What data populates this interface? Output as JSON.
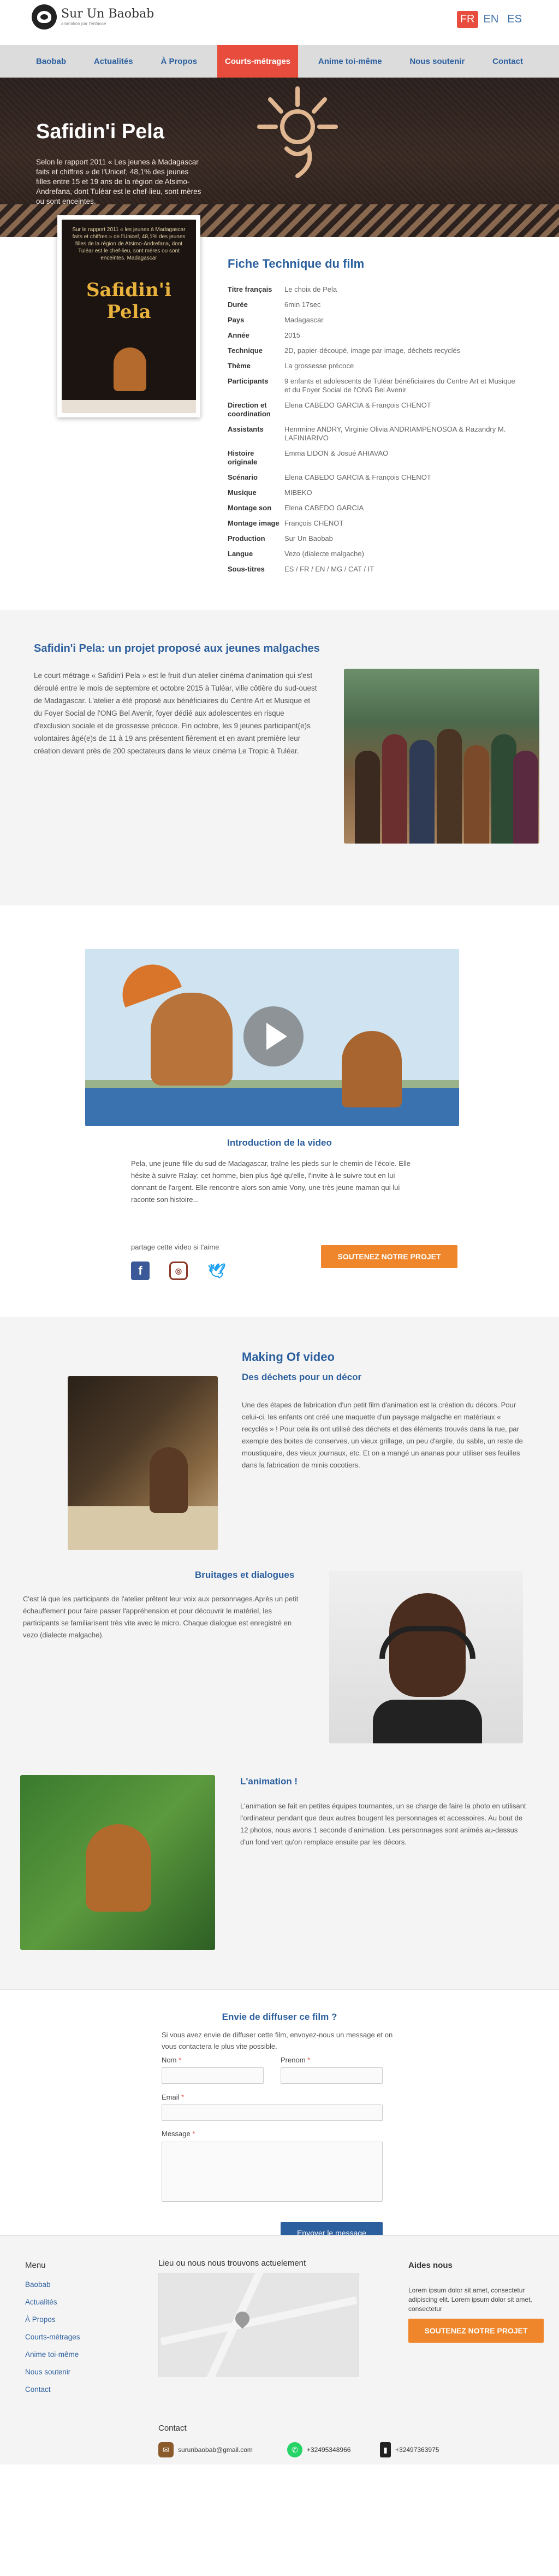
{
  "brand": {
    "name": "Sur Un Baobab",
    "tagline": "animation par l'enfance"
  },
  "languages": [
    {
      "code": "FR",
      "active": true
    },
    {
      "code": "EN",
      "active": false
    },
    {
      "code": "ES",
      "active": false
    }
  ],
  "nav": [
    {
      "label": "Baobab",
      "active": false
    },
    {
      "label": "Actualités",
      "active": false
    },
    {
      "label": "À Propos",
      "active": false
    },
    {
      "label": "Courts-métrages",
      "active": true
    },
    {
      "label": "Anime toi-même",
      "active": false
    },
    {
      "label": "Nous soutenir",
      "active": false
    },
    {
      "label": "Contact",
      "active": false
    }
  ],
  "hero": {
    "title": "Safidin'i Pela",
    "text": "Selon le rapport 2011 « Les jeunes à Madagascar faits et chiffres » de l'Unicef, 48,1% des jeunes filles entre 15 et 19 ans de la région de Atsimo-Andrefana, dont Tuléar est le chef-lieu, sont mères ou sont enceintes."
  },
  "poster": {
    "top_text": "Sur le rapport 2011 « les jeunes à Madagascar faits et chiffres » de l'Unicef, 48,1% des jeunes filles de la région de Atsimo-Andrefana, dont Tuléar est le chef-lieu, sont mères ou sont enceintes. Madagascar",
    "title": "Safidin'i Pela"
  },
  "fiche": {
    "title": "Fiche Technique du film",
    "rows": [
      {
        "k": "Titre français",
        "v": "Le choix de Pela"
      },
      {
        "k": "Durée",
        "v": "6min 17sec"
      },
      {
        "k": "Pays",
        "v": "Madagascar"
      },
      {
        "k": "Année",
        "v": "2015"
      },
      {
        "k": "Technique",
        "v": "2D, papier-découpé, image par image, déchets recyclés"
      },
      {
        "k": "Thème",
        "v": "La grossesse précoce"
      },
      {
        "k": "Participants",
        "v": "9 enfants et adolescents de Tuléar bénéficiaires du Centre Art et Musique et du Foyer Social de l'ONG Bel Avenir"
      },
      {
        "k": "Direction et coordination",
        "v": "Elena CABEDO GARCIA & François CHENOT"
      },
      {
        "k": "Assistants",
        "v": "Henrmine ANDRY, Virginie Olivia ANDRIAMPENOSOA & Razandry M. LAFINIARIVO"
      },
      {
        "k": "Histoire originale",
        "v": "Emma LIDON & Josué AHIAVAO"
      },
      {
        "k": "Scénario",
        "v": "Elena CABEDO GARCIA & François CHENOT"
      },
      {
        "k": "Musique",
        "v": "MIBEKO"
      },
      {
        "k": "Montage son",
        "v": "Elena CABEDO GARCIA"
      },
      {
        "k": "Montage image",
        "v": "François CHENOT"
      },
      {
        "k": "Production",
        "v": "Sur Un Baobab"
      },
      {
        "k": "Langue",
        "v": "Vezo (dialecte malgache)"
      },
      {
        "k": "Sous-titres",
        "v": "ES / FR / EN / MG / CAT / IT"
      }
    ]
  },
  "projet": {
    "title": "Safidin'i Pela: un projet proposé aux jeunes malgaches",
    "text": "Le court métrage « Safidin'i Pela » est le fruit d'un atelier cinéma d'animation qui s'est déroulé entre le mois de septembre et octobre 2015 à Tuléar, ville côtière du sud-ouest de Madagascar. L'atelier a été proposé aux bénéficiaires du Centre Art et Musique et du Foyer Social de l'ONG Bel Avenir, foyer dédié aux adolescentes en risque d'exclusion sociale et de grossesse précoce. Fin octobre, les 9 jeunes participant(e)s volontaires âgé(e)s de 11 à 19 ans présentent fièrement et en avant première leur création devant près de 200 spectateurs dans le vieux cinéma Le Tropic à Tuléar."
  },
  "video": {
    "title": "Introduction de la video",
    "text": "Pela, une jeune fille du sud de Madagascar, traîne les pieds sur le chemin de l'école. Elle hésite à suivre Ralay; cet homme, bien plus âgé qu'elle, l'invite à le suivre tout en lui donnant de l'argent. Elle rencontre alors son amie Vony, une très jeune maman qui lui raconte son histoire...",
    "share_label": "partage cette video si t'aime",
    "support_button": "SOUTENEZ NOTRE PROJET"
  },
  "making": {
    "title": "Making Of video",
    "blocks": [
      {
        "title": "Des déchets pour un décor",
        "text": "Une des étapes de fabrication d'un petit film d'animation est la création du décors. Pour celui-ci, les enfants ont créé une maquette d'un paysage malgache en matériaux « recyclés » ! Pour cela ils ont utilisé des déchets et des éléments trouvés dans la rue, par exemple des boites de conserves, un vieux grillage, un peu d'argile, du sable, un reste de moustiquaire, des vieux journaux, etc. Et on a mangé un ananas pour utiliser ses feuilles dans la fabrication de minis cocotiers."
      },
      {
        "title": "Bruitages et dialogues",
        "text": "C'est là que les participants de l'atelier prêtent leur voix aux personnages.Après un petit échauffement pour faire passer l'appréhension et pour découvrir le matériel, les participants se familiarisent très vite avec le micro. Chaque dialogue est enregistré en vezo (dialecte malgache)."
      },
      {
        "title": "L'animation !",
        "text": "L'animation se fait en petites équipes tournantes, un se charge de faire la photo en utilisant l'ordinateur pendant que deux autres bougent les personnages et accessoires. Au bout de 12 photos, nous avons 1 seconde d'animation. Les personnages sont animés au-dessus d'un fond vert qu'on remplace ensuite par les décors."
      }
    ]
  },
  "form": {
    "title": "Envie de diffuser ce film ?",
    "intro": "Si vous avez envie de diffuser cette film, envoyez-nous un message et on vous contactera le plus vite possible.",
    "nom_label": "Nom",
    "prenom_label": "Prenom",
    "email_label": "Email",
    "message_label": "Message",
    "required_mark": "*",
    "submit": "Envoyer le message"
  },
  "footer": {
    "menu_title": "Menu",
    "menu": [
      "Baobab",
      "Actualités",
      "À Propos",
      "Courts-métrages",
      "Anime toi-même",
      "Nous soutenir",
      "Contact"
    ],
    "map_title": "Lieu ou nous nous trouvons actuelement",
    "aides_title": "Aides nous",
    "aides_text": "Lorem ipsum dolor sit amet, consectetur adipiscing elit. Lorem ipsum dolor sit amet, consectetur",
    "support_button": "SOUTENEZ NOTRE PROJET",
    "contact_title": "Contact",
    "email": "surunbaobab@gmail.com",
    "whatsapp": "+32495348966",
    "phone": "+32497363975"
  },
  "colors": {
    "accent": "#e74c3c",
    "link": "#2c5f9e",
    "orange": "#f0862b"
  }
}
